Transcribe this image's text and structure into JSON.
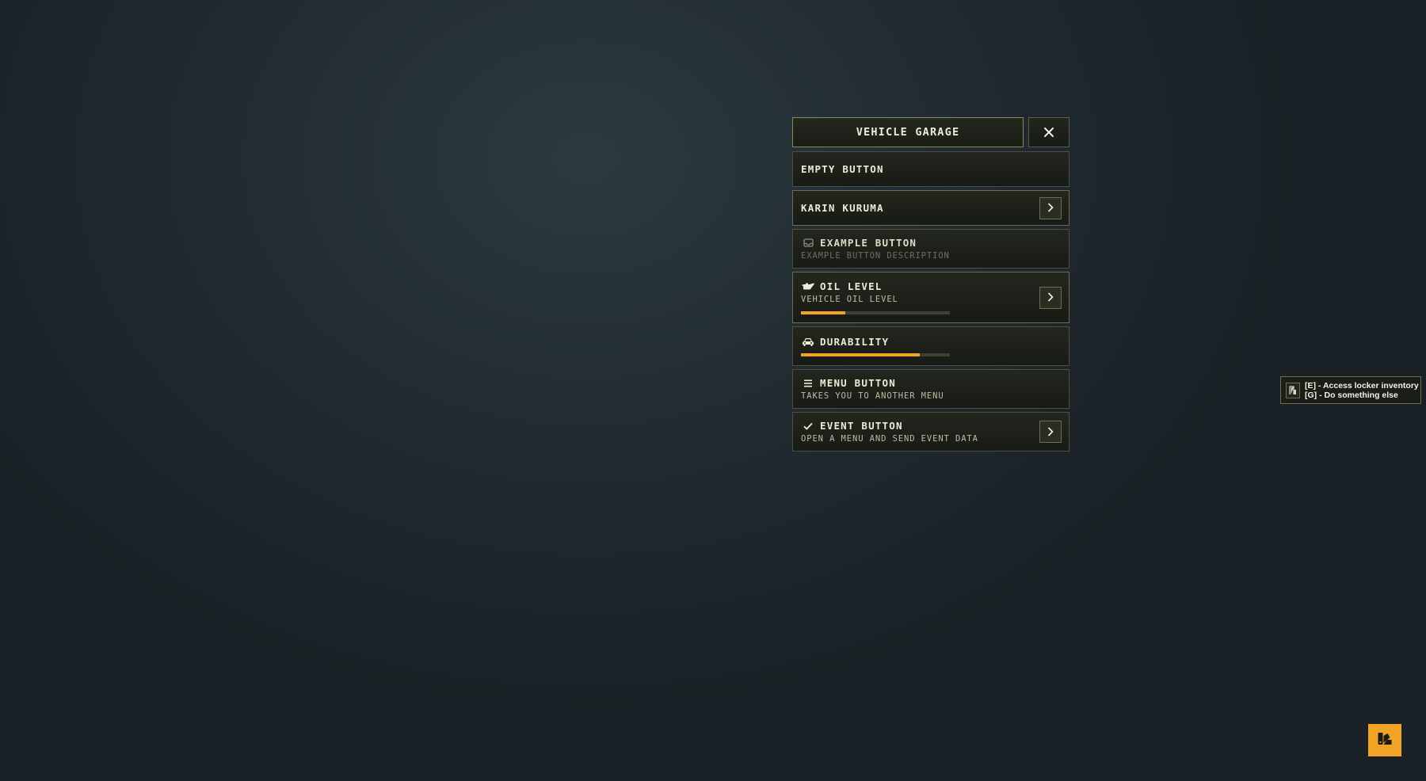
{
  "menu": {
    "title": "VEHICLE GARAGE",
    "close_icon": "close-icon",
    "items": [
      {
        "title": "EMPTY BUTTON"
      },
      {
        "title": "KARIN KURUMA",
        "arrow_icon": "chevron-right-icon"
      },
      {
        "title": "EXAMPLE BUTTON",
        "description": "EXAMPLE BUTTON DESCRIPTION",
        "icon": "inbox-icon",
        "disabled": true
      },
      {
        "title": "OIL LEVEL",
        "description": "VEHICLE OIL LEVEL",
        "icon": "oil-can-icon",
        "progress": 0.3,
        "arrow_icon": "chevron-right-icon"
      },
      {
        "title": "DURABILITY",
        "icon": "car-icon",
        "progress": 0.8
      },
      {
        "title": "MENU BUTTON",
        "description": "TAKES YOU TO ANOTHER MENU",
        "icon": "bars-icon"
      },
      {
        "title": "EVENT BUTTON",
        "description": "OPEN A MENU AND SEND EVENT DATA",
        "icon": "check-icon",
        "arrow_icon": "chevron-right-icon"
      }
    ]
  },
  "tooltip": {
    "icon": "door-icon",
    "lines": [
      "[E] - Access locker inventory",
      "[G] - Do something else"
    ]
  },
  "fab": {
    "icon": "palette-icon"
  },
  "colors": {
    "accent": "#f0a324",
    "panel_border": "#4b5040",
    "title_border": "#8a8a55",
    "text": "#ecebd8"
  }
}
